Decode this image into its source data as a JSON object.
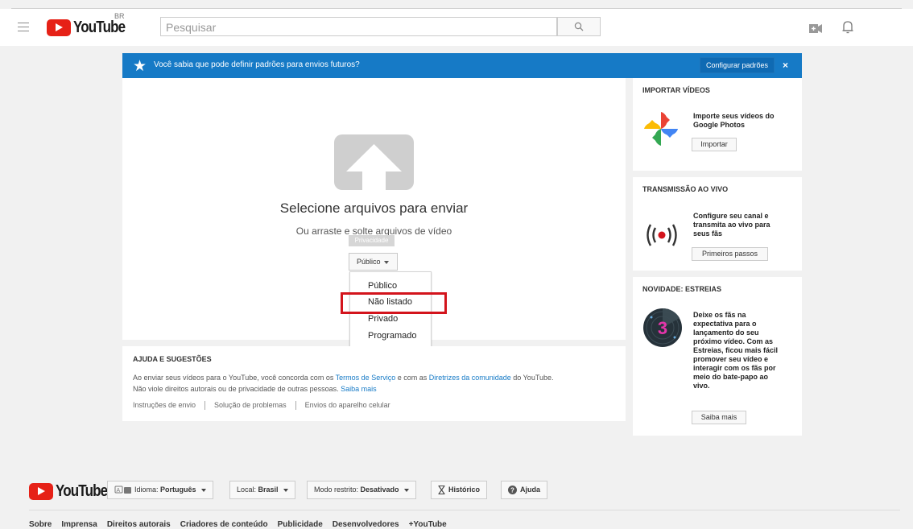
{
  "header": {
    "logo_text": "YouTube",
    "region": "BR",
    "search_placeholder": "Pesquisar"
  },
  "banner": {
    "message": "Você sabia que pode definir padrões para envios futuros?",
    "config_button": "Configurar padrões",
    "close_label": "×"
  },
  "upload": {
    "title": "Selecione arquivos para enviar",
    "subtitle": "Ou arraste e solte arquivos de vídeo",
    "tooltip": "Privacidade",
    "privacy_selected": "Público",
    "options": [
      "Público",
      "Não listado",
      "Privado",
      "Programado"
    ]
  },
  "help": {
    "title": "AJUDA E SUGESTÕES",
    "p1_a": "Ao enviar seus vídeos para o YouTube, você concorda com os ",
    "p1_link1": "Termos de Serviço",
    "p1_b": " e com as ",
    "p1_link2": "Diretrizes da comunidade",
    "p1_c": " do YouTube.",
    "p2_a": "Não viole direitos autorais ou de privacidade de outras pessoas. ",
    "p2_link": "Saiba mais",
    "links": [
      "Instruções de envio",
      "Solução de problemas",
      "Envios do aparelho celular"
    ]
  },
  "cards": {
    "import": {
      "title": "IMPORTAR VÍDEOS",
      "line1": "Importe seus vídeos do",
      "line2": "Google Photos",
      "button": "Importar"
    },
    "live": {
      "title": "TRANSMISSÃO AO VIVO",
      "line1": "Configure seu canal e",
      "line2": "transmita ao vivo para",
      "line3": "seus fãs",
      "button": "Primeiros passos"
    },
    "premiere": {
      "title": "NOVIDADE: ESTREIAS",
      "lines": [
        "Deixe os fãs na",
        "expectativa para o",
        "lançamento do seu",
        "próximo vídeo. Com as",
        "Estreias, ficou mais fácil",
        "promover seu vídeo e",
        "interagir com os fãs por",
        "meio do bate-papo ao",
        "vivo."
      ],
      "button": "Saiba mais",
      "badge_number": "3"
    }
  },
  "footer": {
    "logo_text": "YouTube",
    "language_label": "Idioma: ",
    "language_value": "Português",
    "location_label": "Local: ",
    "location_value": "Brasil",
    "restricted_label": "Modo restrito: ",
    "restricted_value": "Desativado",
    "history": "Histórico",
    "help": "Ajuda",
    "links": [
      "Sobre",
      "Imprensa",
      "Direitos autorais",
      "Criadores de conteúdo",
      "Publicidade",
      "Desenvolvedores",
      "+YouTube"
    ]
  },
  "colors": {
    "brand_red": "#e62117",
    "banner_blue": "#167ac6",
    "highlight_red": "#d3141c"
  }
}
